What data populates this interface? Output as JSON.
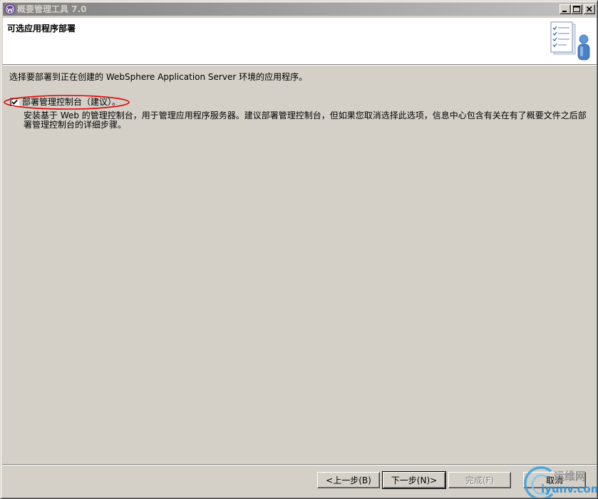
{
  "window": {
    "title": "概要管理工具 7.0",
    "icon": "app-icon",
    "controls": {
      "minimize_icon": "minimize-icon",
      "maximize_icon": "maximize-icon",
      "close_icon": "close-icon"
    }
  },
  "header": {
    "title": "可选应用程序部署",
    "icon": "checklist-user-icon"
  },
  "body": {
    "intro": "选择要部署到正在创建的 WebSphere Application Server 环境的应用程序。",
    "options": [
      {
        "label": "部署管理控制台（建议）。",
        "checked": true,
        "description": "安装基于 Web 的管理控制台，用于管理应用程序服务器。建议部署管理控制台，但如果您取消选择此选项，信息中心包含有关在有了概要文件之后部署管理控制台的详细步骤。"
      }
    ]
  },
  "buttons": {
    "back": "<上一步(B)",
    "next": "下一步(N)>",
    "finish": "完成(F)",
    "cancel": "取消"
  },
  "button_states": {
    "finish_enabled": false,
    "next_is_default": true
  },
  "watermark": {
    "title": "运维网",
    "url": "iyunv.com"
  },
  "colors": {
    "face": "#d4d0c8",
    "annotation": "#e00000",
    "watermark_blue": "#2a8fd6"
  }
}
